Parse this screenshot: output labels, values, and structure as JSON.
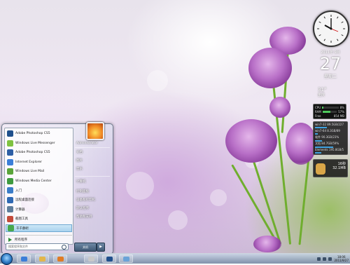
{
  "gadgets": {
    "clock": {
      "time": "10:06"
    },
    "date": {
      "year_month": "2011年 9月",
      "day": "27",
      "weekday": "星期二"
    },
    "weather": {
      "line1": "31°",
      "line2": "重庆"
    },
    "cpu": {
      "cpu_label": "CPU",
      "cpu_value": "8%",
      "ram_label": "RAM",
      "ram_value": "57%",
      "free_label": "Free",
      "free_value": "854 MB",
      "cpu_fill": 0.08,
      "ram_fill": 0.57
    },
    "drives": [
      {
        "label": "win7-32 89.5GB/227",
        "fill": 0.39
      },
      {
        "label": "win7-64 8.3GB/89",
        "fill": 0.09
      },
      {
        "label": "软件 90.3GB/23%",
        "fill": 0.23
      },
      {
        "label": "文档 84.7GB/59%",
        "fill": 0.59
      },
      {
        "label": "Elements 195.8GB/5",
        "fill": 0.2
      }
    ],
    "network": {
      "line1": "16秒",
      "line2": "32.1MB"
    }
  },
  "start_menu": {
    "programs": [
      {
        "label": "Adobe Photoshop CS5",
        "icon": "photoshop-icon",
        "color": "#1f4f8c"
      },
      {
        "label": "Windows Live Messenger",
        "icon": "messenger-icon",
        "color": "#7fc241"
      },
      {
        "label": "Adobe Photoshop CS5",
        "icon": "photoshop-icon",
        "color": "#2d5ea5"
      },
      {
        "label": "Internet Explorer",
        "icon": "ie-icon",
        "color": "#3b7ed8"
      },
      {
        "label": "Windows Live Mail",
        "icon": "mail-icon",
        "color": "#5aa43a"
      },
      {
        "label": "Windows Media Center",
        "icon": "media-center-icon",
        "color": "#3f9a3f"
      },
      {
        "label": "入门",
        "icon": "getting-started-icon",
        "color": "#3a7cc8"
      },
      {
        "label": "远程桌面连接",
        "icon": "remote-desktop-icon",
        "color": "#2f69b3"
      },
      {
        "label": "计算器",
        "icon": "calculator-icon",
        "color": "#5e7d9b"
      },
      {
        "label": "截图工具",
        "icon": "snipping-tool-icon",
        "color": "#c34a3a"
      },
      {
        "label": "千千静听",
        "icon": "music-player-icon",
        "color": "#47a84c"
      }
    ],
    "all_programs": "所有程序",
    "search_placeholder": "搜索程序和文件",
    "right_items": [
      "Administrator",
      "文档",
      "图片",
      "音乐",
      "计算机",
      "控制面板",
      "设备和打印机",
      "默认程序",
      "帮助和支持"
    ],
    "shutdown": "关机",
    "shutdown_arrow": "▶"
  },
  "taskbar": {
    "apps": [
      {
        "name": "ie",
        "color": "#3b7ed8"
      },
      {
        "name": "explorer",
        "color": "#e3b64a"
      },
      {
        "name": "media-player",
        "color": "#e07b24"
      },
      {
        "name": "paint",
        "color": "#c9c9c9"
      },
      {
        "name": "photoshop",
        "color": "#1f4f8c"
      },
      {
        "name": "display",
        "color": "#6aa3d8"
      }
    ],
    "time": "18:06",
    "date": "2011/9/27"
  }
}
